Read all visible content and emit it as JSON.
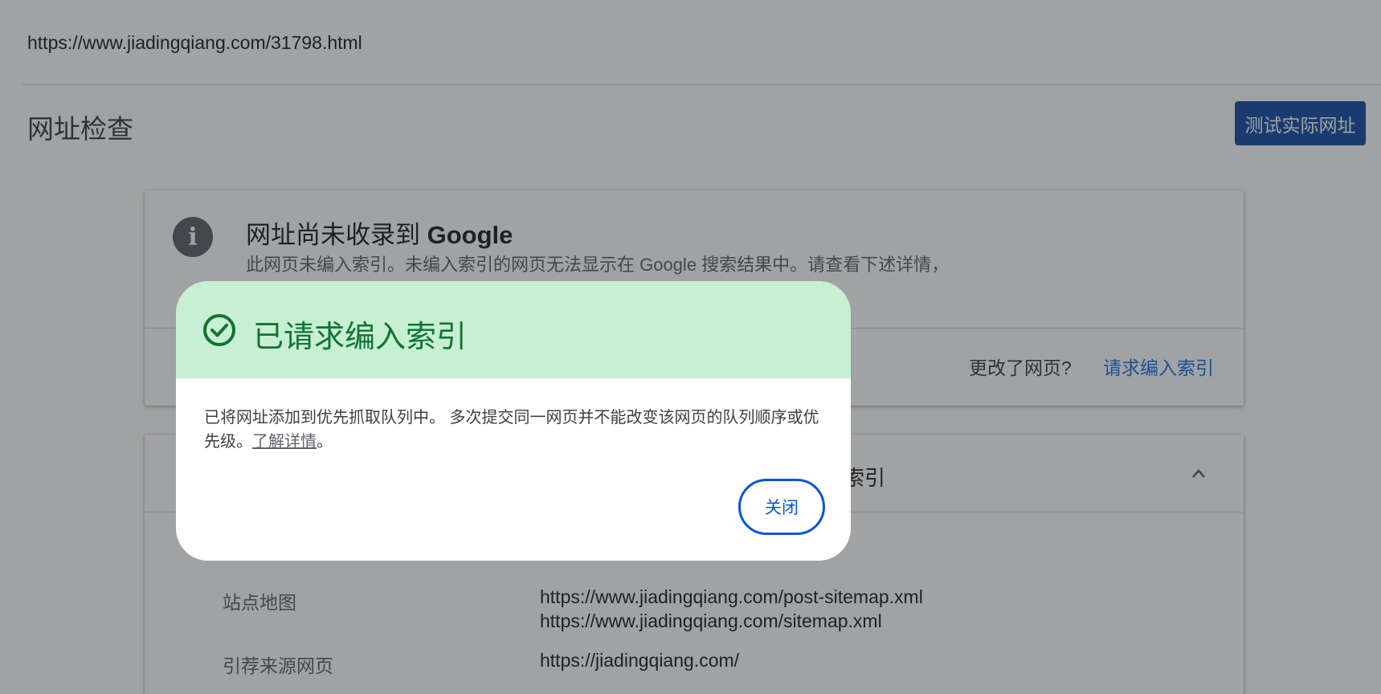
{
  "url": "https://www.jiadingqiang.com/31798.html",
  "page_title": "网址检查",
  "test_button_label": "测试实际网址",
  "status_card": {
    "info_icon_glyph": "i",
    "title_prefix": "网址尚未收录到 ",
    "title_google": "Google",
    "description": "此网页未编入索引。未编入索引的网页无法显示在 Google 搜索结果中。请查看下述详情，了解为何没有编入索引。了解详情",
    "changed_label": "更改了网页?",
    "request_index_label": "请求编入索引"
  },
  "details_card": {
    "header_text_partial": "索引",
    "rows": [
      {
        "label": "站点地图",
        "values": [
          "https://www.jiadingqiang.com/post-sitemap.xml",
          "https://www.jiadingqiang.com/sitemap.xml"
        ]
      },
      {
        "label": "引荐来源网页",
        "values": [
          "https://jiadingqiang.com/"
        ]
      }
    ]
  },
  "dialog": {
    "title": "已请求编入索引",
    "body_text": "已将网址添加到优先抓取队列中。 多次提交同一网页并不能改变该网页的队列顺序或优先级。",
    "learn_more": "了解详情",
    "body_end": "。",
    "close_label": "关闭"
  },
  "colors": {
    "primary_button": "#174ea6",
    "success_header_bg": "#c6efd3",
    "success_text": "#137333",
    "close_border": "#0b57d0"
  },
  "icons": {
    "info": "info-icon",
    "chevron": "chevron-up-icon",
    "check": "check-circle-icon"
  }
}
